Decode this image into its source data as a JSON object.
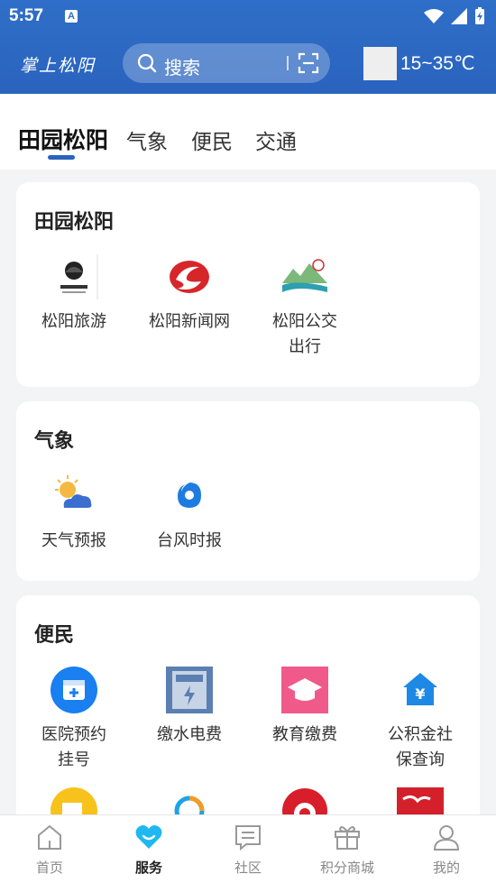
{
  "status": {
    "time": "5:57",
    "a_badge": "A"
  },
  "header": {
    "logo": "掌上松阳",
    "search_placeholder": "搜索",
    "temperature": "15~35℃"
  },
  "tabs": [
    "田园松阳",
    "气象",
    "便民",
    "交通"
  ],
  "sections": {
    "tianyuan": {
      "title": "田园松阳",
      "items": [
        "松阳旅游",
        "松阳新闻网",
        "松阳公交出行"
      ]
    },
    "qixiang": {
      "title": "气象",
      "items": [
        "天气预报",
        "台风时报"
      ]
    },
    "bianmin": {
      "title": "便民",
      "items": [
        "医院预约挂号",
        "缴水电费",
        "教育缴费",
        "公积金社保查询"
      ]
    }
  },
  "bottom_nav": [
    "首页",
    "服务",
    "社区",
    "积分商城",
    "我的"
  ],
  "colors": {
    "brand_blue": "#2a63be",
    "active_nav": "#1fb8f0"
  }
}
